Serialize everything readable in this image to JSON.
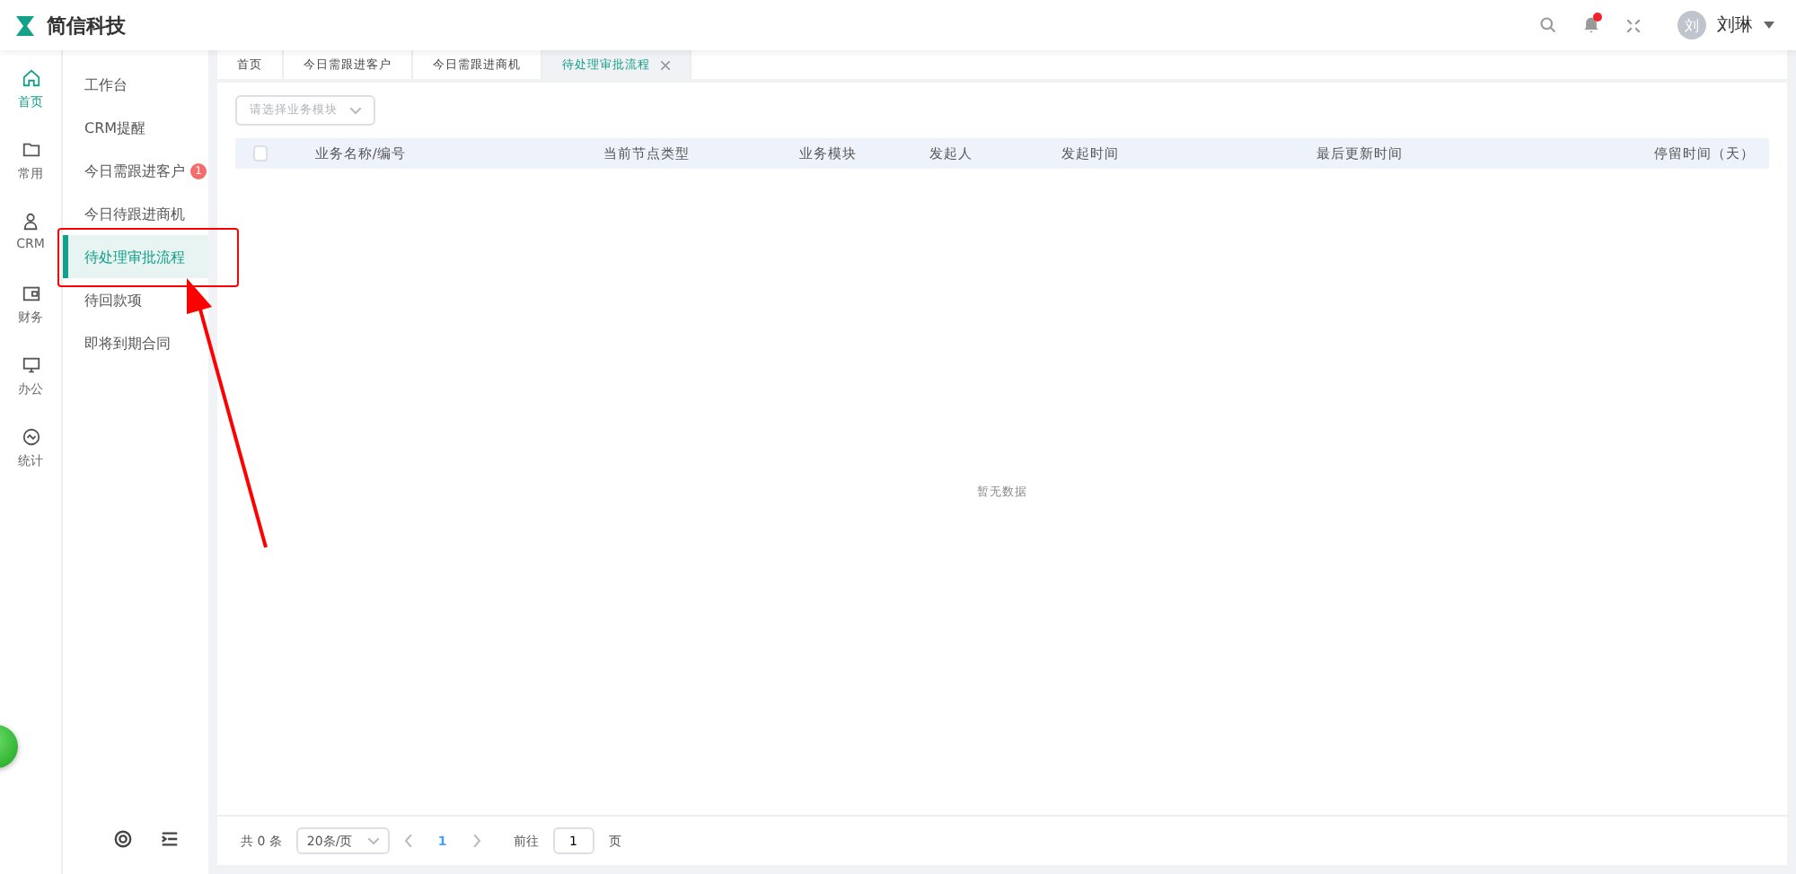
{
  "header": {
    "brand": "简信科技",
    "notification_dot": true,
    "user": {
      "avatar": "刘",
      "name": "刘琳"
    }
  },
  "rail": [
    {
      "kind": "home",
      "label": "首页",
      "selected": true
    },
    {
      "kind": "folder",
      "label": "常用",
      "selected": false
    },
    {
      "kind": "user",
      "label": "CRM",
      "selected": false
    },
    {
      "kind": "wallet",
      "label": "财务",
      "selected": false
    },
    {
      "kind": "monitor",
      "label": "办公",
      "selected": false
    },
    {
      "kind": "chart",
      "label": "统计",
      "selected": false
    }
  ],
  "submenu": [
    {
      "label": "工作台",
      "selected": false,
      "highlighted": false
    },
    {
      "label": "CRM提醒",
      "selected": false,
      "highlighted": false
    },
    {
      "label": "今日需跟进客户",
      "badge": "1",
      "selected": false,
      "highlighted": false
    },
    {
      "label": "今日待跟进商机",
      "selected": false,
      "highlighted": false
    },
    {
      "label": "待处理审批流程",
      "selected": true,
      "highlighted": true
    },
    {
      "label": "待回款项",
      "selected": false,
      "highlighted": false
    },
    {
      "label": "即将到期合同",
      "selected": false,
      "highlighted": false
    }
  ],
  "tabs": [
    {
      "label": "首页",
      "selected": false,
      "closable": false
    },
    {
      "label": "今日需跟进客户",
      "selected": false,
      "closable": false
    },
    {
      "label": "今日需跟进商机",
      "selected": false,
      "closable": false
    },
    {
      "label": "待处理审批流程",
      "selected": true,
      "closable": true
    }
  ],
  "filter": {
    "placeholder": "请选择业务模块"
  },
  "table": {
    "checked": false,
    "columns": [
      "业务名称/编号",
      "当前节点类型",
      "业务模块",
      "发起人",
      "发起时间",
      "最后更新时间",
      "停留时间（天）"
    ],
    "empty_text": "暂无数据"
  },
  "pagination": {
    "total": "共 0 条",
    "page_size": "20条/页",
    "pages": [
      {
        "label": "1",
        "selected": true
      }
    ],
    "goto_label": "前往",
    "goto_value": "1",
    "goto_suffix": "页"
  }
}
